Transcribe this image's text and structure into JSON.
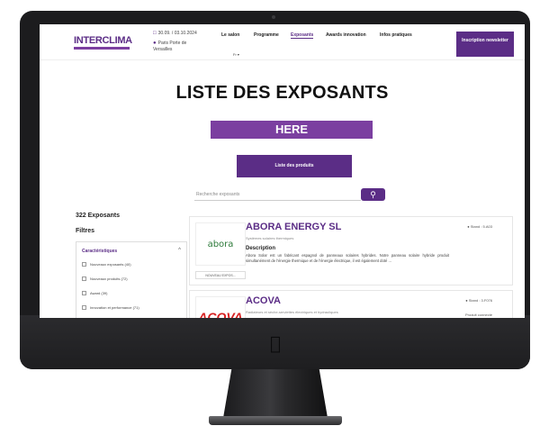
{
  "header": {
    "logo_text": "INTERCLIMA",
    "date_text": "30.09. / 03.10.2024",
    "venue_text": "Paris Porte de Versailles",
    "nav": [
      {
        "label": "Le salon"
      },
      {
        "label": "Programme"
      },
      {
        "label": "Exposants"
      },
      {
        "label": "Awards innovation"
      },
      {
        "label": "Infos pratiques"
      }
    ],
    "language": "Fr",
    "cta_label": "Inscription newsletter"
  },
  "hero": {
    "title": "LISTE DES EXPOSANTS",
    "here_label": "HERE",
    "products_button": "Liste des produits"
  },
  "search": {
    "placeholder": "Recherche exposants",
    "button_icon": "search-icon"
  },
  "sidebar": {
    "count_label": "322 Exposants",
    "filters_title": "Filtres",
    "characteristics_title": "Caractéristiques",
    "items": [
      {
        "label": "Nouveaux exposants (40)"
      },
      {
        "label": "Nouveaux produits (72)"
      },
      {
        "label": "Award (39)"
      },
      {
        "label": "Innovation et performance (71)"
      }
    ]
  },
  "exhibitors": [
    {
      "name": "ABORA ENERGY SL",
      "logo_text": "abora",
      "stand": "Stand : 5.A03",
      "subtitle": "Systèmes solaires thermiques",
      "description_title": "Description",
      "description": "Abora Solar est un fabricant espagnol de panneaux solaires hybrides. Notre panneau solaire hybride produit simultanément de l'énergie thermique et de l'énergie électrique, il est également doté ...",
      "tag": "NOUVEAU EXPOS..."
    },
    {
      "name": "ACOVA",
      "logo_text": "ACOVA",
      "stand": "Stand : 3.F076",
      "subtitle": "Radiateurs et sèche-serviettes électriques et hydrauliques",
      "extra": "Produit connecté"
    }
  ],
  "colors": {
    "brand_purple": "#5b2d86",
    "here_purple": "#7b3fa0",
    "acova_red": "#d62020",
    "abora_green": "#2d7a3a"
  }
}
